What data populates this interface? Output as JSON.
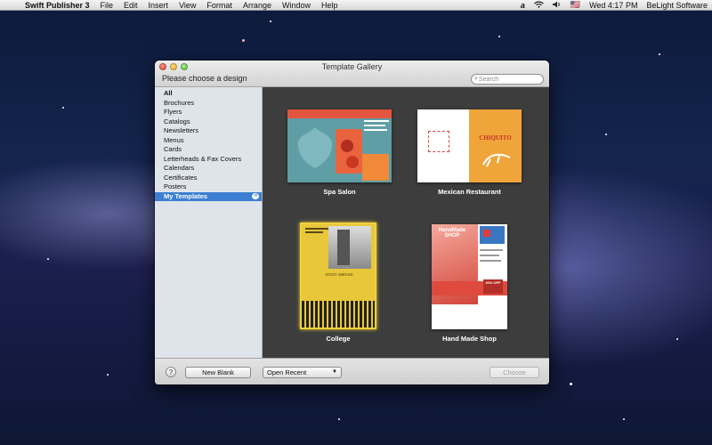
{
  "menubar": {
    "apple": "",
    "app_name": "Swift Publisher 3",
    "items": [
      "File",
      "Edit",
      "Insert",
      "View",
      "Format",
      "Arrange",
      "Window",
      "Help"
    ],
    "right": {
      "flag": "🇺🇸",
      "clock": "Wed 4:17 PM",
      "user": "BeLight Software"
    }
  },
  "window": {
    "title": "Template Gallery",
    "subtitle": "Please choose a design",
    "search_placeholder": "Search"
  },
  "sidebar": {
    "items": [
      {
        "label": "All",
        "bold": true
      },
      {
        "label": "Brochures"
      },
      {
        "label": "Flyers"
      },
      {
        "label": "Catalogs"
      },
      {
        "label": "Newsletters"
      },
      {
        "label": "Menus"
      },
      {
        "label": "Cards"
      },
      {
        "label": "Letterheads & Fax Covers"
      },
      {
        "label": "Calendars"
      },
      {
        "label": "Certificates"
      },
      {
        "label": "Posters"
      },
      {
        "label": "My Templates",
        "selected": true
      }
    ]
  },
  "templates": [
    {
      "name": "Spa Salon"
    },
    {
      "name": "Mexican Restaurant",
      "thumb_brand": "CHIQUITO"
    },
    {
      "name": "College",
      "selected": true,
      "thumb_heading": "STUDY ABROAD"
    },
    {
      "name": "Hand Made Shop",
      "thumb_brand": "HandMade SHOP",
      "thumb_badge": "20% OFF"
    }
  ],
  "footer": {
    "help": "?",
    "new_blank": "New Blank",
    "open_recent": "Open Recent",
    "choose": "Choose"
  },
  "colors": {
    "selection_blue": "#3d7fd2",
    "gallery_bg": "#3d3d3d",
    "college_highlight": "#f0d23a"
  }
}
